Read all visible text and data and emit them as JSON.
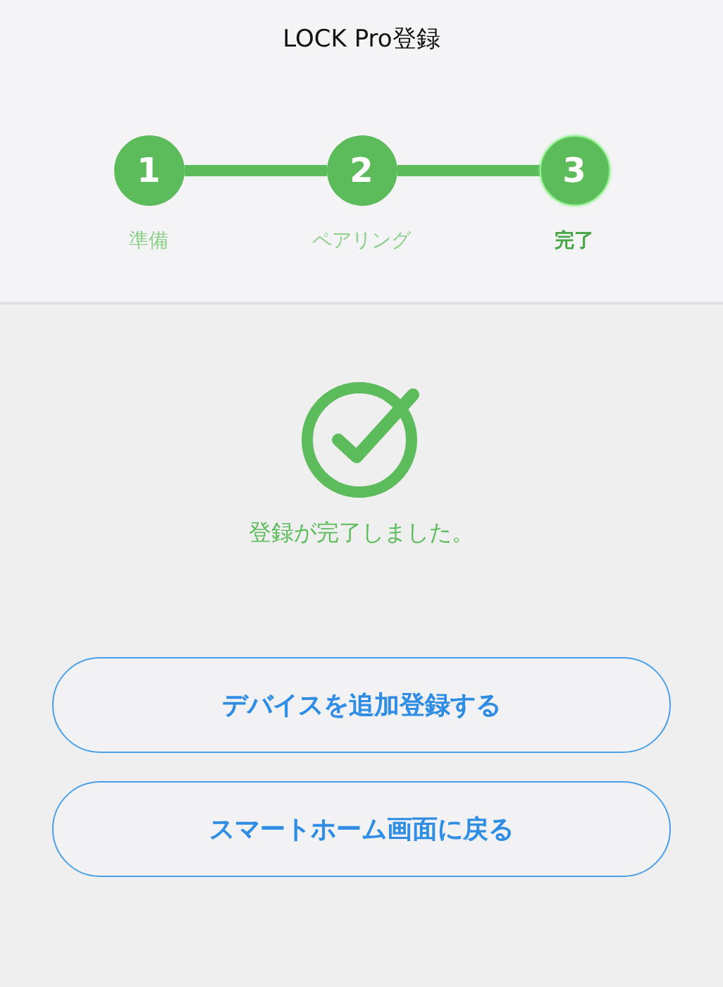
{
  "header": {
    "title": "LOCK Pro登録"
  },
  "steps": [
    {
      "number": "1",
      "label": "準備",
      "selected": false
    },
    {
      "number": "2",
      "label": "ペアリング",
      "selected": false
    },
    {
      "number": "3",
      "label": "完了",
      "selected": true
    }
  ],
  "result": {
    "message": "登録が完了しました。"
  },
  "buttons": [
    {
      "label": "デバイスを追加登録する"
    },
    {
      "label": "スマートホーム画面に戻る"
    }
  ]
}
